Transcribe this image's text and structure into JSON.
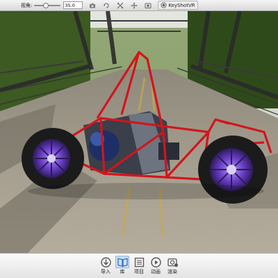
{
  "toolbar": {
    "fov_label": "视角:",
    "fov_value": "35.0",
    "fov_level": 0.45,
    "keyshotvr_label": "KeyShotVR",
    "icons": [
      "camera-icon",
      "tumble-icon",
      "move-icon",
      "pan-icon",
      "screenshot-icon",
      "keyshotvr-icon"
    ]
  },
  "bottom_bar": {
    "tools": [
      {
        "name": "import",
        "label": "导入",
        "icon": "import-icon",
        "active": false
      },
      {
        "name": "library",
        "label": "库",
        "icon": "library-icon",
        "active": true
      },
      {
        "name": "project",
        "label": "项目",
        "icon": "project-icon",
        "active": false
      },
      {
        "name": "animation",
        "label": "动画",
        "icon": "animation-icon",
        "active": false
      },
      {
        "name": "render",
        "label": "渲染",
        "icon": "render-icon",
        "active": false
      }
    ]
  },
  "colors": {
    "frame": "#d4141c",
    "rim": "#6a3fc8",
    "tire": "#1b1b1b",
    "road": "#a39c8c",
    "sky": "#d8dcd6",
    "accent": "#2f6fc0"
  }
}
